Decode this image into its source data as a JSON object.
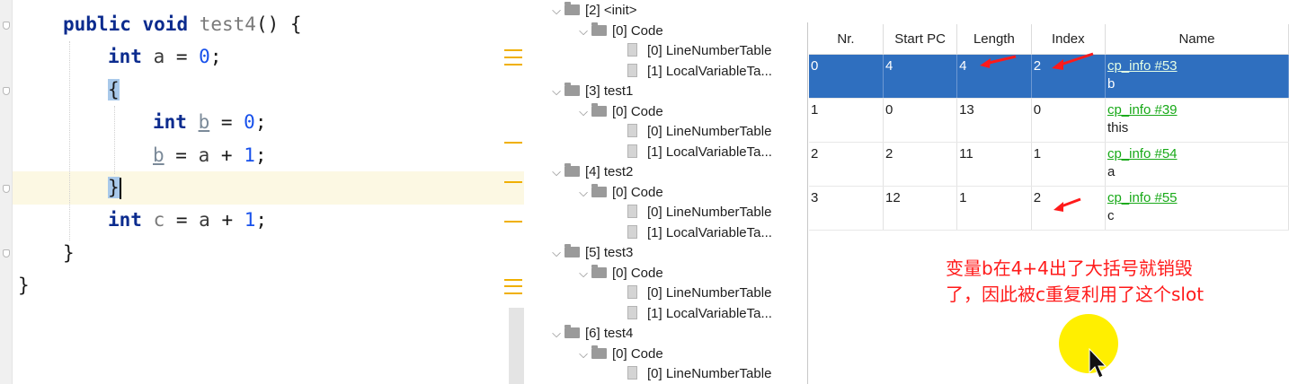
{
  "editor": {
    "lines": [
      {
        "tokens": [
          {
            "t": "public ",
            "c": "kw"
          },
          {
            "t": "void ",
            "c": "kw"
          },
          {
            "t": "test4",
            "c": "grey"
          },
          {
            "t": "() {",
            "c": "plain"
          }
        ]
      },
      {
        "tokens": [
          {
            "t": "int ",
            "c": "kw"
          },
          {
            "t": "a",
            "c": "ident"
          },
          {
            "t": " = ",
            "c": "plain"
          },
          {
            "t": "0",
            "c": "num"
          },
          {
            "t": ";",
            "c": "plain"
          }
        ]
      },
      {
        "tokens": [
          {
            "t": "{",
            "c": "bracehl"
          }
        ]
      },
      {
        "tokens": [
          {
            "t": "int ",
            "c": "kw"
          },
          {
            "t": "b",
            "c": "varb"
          },
          {
            "t": " = ",
            "c": "plain"
          },
          {
            "t": "0",
            "c": "num"
          },
          {
            "t": ";",
            "c": "plain"
          }
        ]
      },
      {
        "tokens": [
          {
            "t": "b",
            "c": "varb"
          },
          {
            "t": " = ",
            "c": "plain"
          },
          {
            "t": "a",
            "c": "ident"
          },
          {
            "t": " + ",
            "c": "plain"
          },
          {
            "t": "1",
            "c": "num"
          },
          {
            "t": ";",
            "c": "plain"
          }
        ]
      },
      {
        "tokens": [
          {
            "t": "}",
            "c": "bracehl"
          },
          {
            "t": "",
            "c": "caret"
          }
        ]
      },
      {
        "tokens": [
          {
            "t": "int ",
            "c": "kw"
          },
          {
            "t": "c",
            "c": "grey"
          },
          {
            "t": " = ",
            "c": "plain"
          },
          {
            "t": "a",
            "c": "ident"
          },
          {
            "t": " + ",
            "c": "plain"
          },
          {
            "t": "1",
            "c": "num"
          },
          {
            "t": ";",
            "c": "plain"
          }
        ]
      },
      {
        "tokens": [
          {
            "t": "}",
            "c": "plain"
          }
        ]
      },
      {
        "tokens": [
          {
            "t": "}",
            "c": "plain"
          }
        ]
      }
    ]
  },
  "tree": {
    "nodes": [
      {
        "label": "[2] <init>",
        "kind": "folder",
        "expanded": true
      },
      {
        "label": "[0] Code",
        "kind": "folder",
        "expanded": true
      },
      {
        "label": "[0] LineNumberTable",
        "kind": "file"
      },
      {
        "label": "[1] LocalVariableTa...",
        "kind": "file"
      },
      {
        "label": "[3] test1",
        "kind": "folder",
        "expanded": true
      },
      {
        "label": "[0] Code",
        "kind": "folder",
        "expanded": true
      },
      {
        "label": "[0] LineNumberTable",
        "kind": "file"
      },
      {
        "label": "[1] LocalVariableTa...",
        "kind": "file"
      },
      {
        "label": "[4] test2",
        "kind": "folder",
        "expanded": true
      },
      {
        "label": "[0] Code",
        "kind": "folder",
        "expanded": true
      },
      {
        "label": "[0] LineNumberTable",
        "kind": "file"
      },
      {
        "label": "[1] LocalVariableTa...",
        "kind": "file"
      },
      {
        "label": "[5] test3",
        "kind": "folder",
        "expanded": true
      },
      {
        "label": "[0] Code",
        "kind": "folder",
        "expanded": true
      },
      {
        "label": "[0] LineNumberTable",
        "kind": "file"
      },
      {
        "label": "[1] LocalVariableTa...",
        "kind": "file"
      },
      {
        "label": "[6] test4",
        "kind": "folder",
        "expanded": true
      },
      {
        "label": "[0] Code",
        "kind": "folder",
        "expanded": true
      },
      {
        "label": "[0] LineNumberTable",
        "kind": "file"
      }
    ]
  },
  "table": {
    "headers": [
      "Nr.",
      "Start PC",
      "Length",
      "Index",
      "Name"
    ],
    "rows": [
      {
        "nr": "0",
        "start_pc": "4",
        "length": "4",
        "index": "2",
        "cp": "cp_info #53",
        "name": "b",
        "selected": true
      },
      {
        "nr": "1",
        "start_pc": "0",
        "length": "13",
        "index": "0",
        "cp": "cp_info #39",
        "name": "this",
        "selected": false
      },
      {
        "nr": "2",
        "start_pc": "2",
        "length": "11",
        "index": "1",
        "cp": "cp_info #54",
        "name": "a",
        "selected": false
      },
      {
        "nr": "3",
        "start_pc": "12",
        "length": "1",
        "index": "2",
        "cp": "cp_info #55",
        "name": "c",
        "selected": false
      }
    ]
  },
  "annotation": {
    "line1": "变量b在4+4出了大括号就销毁",
    "line2": "了，因此被c重复利用了这个slot"
  },
  "colors": {
    "selection": "#2f6fbf",
    "link": "#18a918",
    "annotation": "#ff1a1a",
    "cursor_highlight": "#ffef00",
    "keyword": "#0b2b8e",
    "number": "#1750eb"
  }
}
